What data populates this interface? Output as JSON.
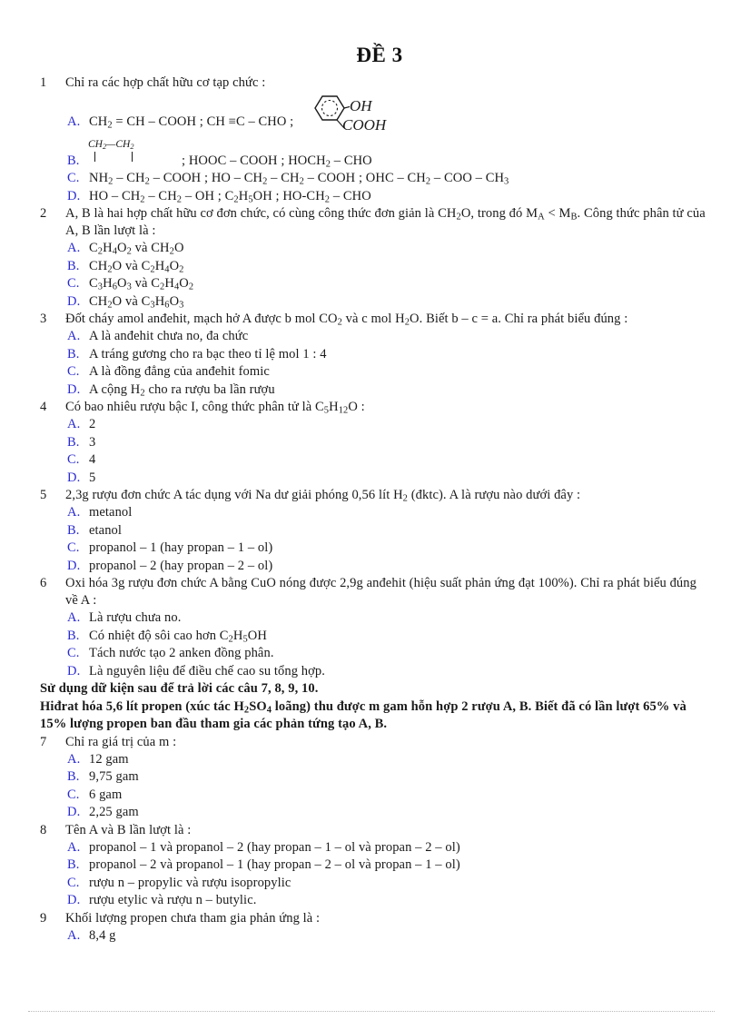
{
  "document": {
    "title": "ĐỀ 3"
  },
  "questions": [
    {
      "number": "1",
      "stem": "Chỉ ra các hợp chất hữu cơ tạp chức :",
      "options": [
        {
          "letter": "A.",
          "text": "CH2 = CH – COOH ; CH ≡C – CHO ;"
        },
        {
          "letter": "B.",
          "text": "; HOOC – COOH ; HOCH2 – CHO"
        },
        {
          "letter": "C.",
          "text": "NH2 – CH2 – COOH ; HO – CH2 – CH2 – COOH ; OHC – CH2 – COO – CH3"
        },
        {
          "letter": "D.",
          "text": "HO – CH2 – CH2 – OH ; C2H5OH ; HO-CH2 – CHO"
        }
      ]
    },
    {
      "number": "2",
      "stem": "A, B là hai hợp chất hữu cơ đơn chức, có cùng công thức đơn giản là CH2O, trong đó MA < MB. Công thức phân tử của A, B lần lượt là :",
      "options": [
        {
          "letter": "A.",
          "text": "C2H4O2 và CH2O"
        },
        {
          "letter": "B.",
          "text": "CH2O và C2H4O2"
        },
        {
          "letter": "C.",
          "text": "C3H6O3 và C2H4O2"
        },
        {
          "letter": "D.",
          "text": "CH2O và C3H6O3"
        }
      ]
    },
    {
      "number": "3",
      "stem": "Đốt cháy amol anđehit, mạch hở A được b mol CO2 và c mol H2O. Biết b – c = a. Chỉ ra phát biểu đúng :",
      "options": [
        {
          "letter": "A.",
          "text": "A là anđehit chưa no, đa chức"
        },
        {
          "letter": "B.",
          "text": "A tráng gương cho ra bạc theo tỉ lệ mol 1 : 4"
        },
        {
          "letter": "C.",
          "text": "A là đồng đẳng của anđehit fomic"
        },
        {
          "letter": "D.",
          "text": "A cộng H2 cho ra rượu ba lần rượu"
        }
      ]
    },
    {
      "number": "4",
      "stem": "Có bao nhiêu rượu bậc I, công thức phân tử là C5H12O :",
      "options": [
        {
          "letter": "A.",
          "text": "2"
        },
        {
          "letter": "B.",
          "text": "3"
        },
        {
          "letter": "C.",
          "text": "4"
        },
        {
          "letter": "D.",
          "text": "5"
        }
      ]
    },
    {
      "number": "5",
      "stem": "2,3g rượu đơn chức A tác dụng với Na dư giải phóng 0,56 lít H2 (đktc). A là rượu nào dưới đây :",
      "options": [
        {
          "letter": "A.",
          "text": "metanol"
        },
        {
          "letter": "B.",
          "text": "etanol"
        },
        {
          "letter": "C.",
          "text": "propanol – 1 (hay propan – 1 – ol)"
        },
        {
          "letter": "D.",
          "text": "propanol – 2 (hay propan – 2 – ol)"
        }
      ]
    },
    {
      "number": "6",
      "stem": "Oxi hóa 3g rượu đơn chức A bằng CuO nóng được 2,9g anđehit (hiệu suất phản ứng đạt 100%). Chỉ ra phát biểu đúng về A :",
      "options": [
        {
          "letter": "A.",
          "text": "Là rượu chưa no."
        },
        {
          "letter": "B.",
          "text": "Có nhiệt độ sôi cao hơn C2H5OH"
        },
        {
          "letter": "C.",
          "text": "Tách nước tạo 2 anken đồng phân."
        },
        {
          "letter": "D.",
          "text": "Là nguyên liệu để điều chế cao su tổng hợp."
        }
      ]
    },
    {
      "number": "7",
      "stem": "Chỉ ra giá trị của m :",
      "options": [
        {
          "letter": "A.",
          "text": "12 gam"
        },
        {
          "letter": "B.",
          "text": "9,75 gam"
        },
        {
          "letter": "C.",
          "text": "6 gam"
        },
        {
          "letter": "D.",
          "text": "2,25 gam"
        }
      ]
    },
    {
      "number": "8",
      "stem": "Tên A và B lần lượt là :",
      "options": [
        {
          "letter": "A.",
          "text": "propanol – 1 và propanol – 2 (hay propan – 1 – ol và propan – 2 – ol)"
        },
        {
          "letter": "B.",
          "text": "propanol – 2 và propanol – 1 (hay propan – 2 – ol và propan – 1 – ol)"
        },
        {
          "letter": "C.",
          "text": "rượu n – propylic  và rượu isopropylic"
        },
        {
          "letter": "D.",
          "text": "rượu etylic  và rượu n – butylic."
        }
      ]
    },
    {
      "number": "9",
      "stem": "Khối lượng propen chưa tham gia phản ứng là :",
      "options": [
        {
          "letter": "A.",
          "text": "8,4 g"
        }
      ]
    }
  ],
  "note": {
    "line1": "Sử dụng dữ kiện sau để trả lời các câu 7, 8, 9, 10.",
    "line2": "Hiđrat hóa 5,6 lít propen (xúc tác H2SO4 loãng) thu được m gam hỗn hợp 2 rượu A, B. Biết đã có lần lượt 65% và 15% lượng propen ban đầu tham gia các phản tứng tạo A, B."
  },
  "structures": {
    "salicylic_oh": "OH",
    "salicylic_cooh": "COOH",
    "fragment_ch2_left": "CH2",
    "fragment_dash": "—",
    "fragment_ch2_right": "CH2",
    "fragment_oh": "OH",
    "fragment_cooh": "COOH"
  },
  "colors": {
    "option_letter": "#2a2ad0",
    "text": "#1a1a1a",
    "footer_rule": "#b9b9b9"
  }
}
